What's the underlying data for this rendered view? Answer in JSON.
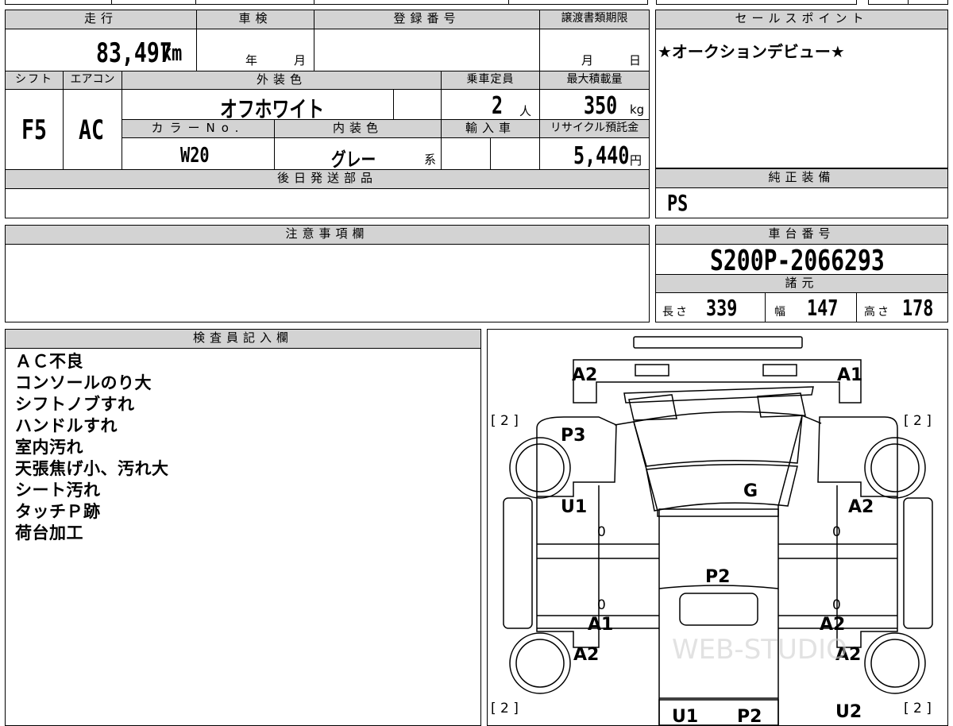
{
  "top_strip": {
    "partial_text": ""
  },
  "main": {
    "mileage_header": "走行",
    "mileage_value": "83,497",
    "mileage_unit": "km",
    "inspection_header": "車検",
    "inspection_year": "年",
    "inspection_month": "月",
    "reg_no_header": "登録番号",
    "reg_no_value": "",
    "transfer_header": "譲渡書類期限",
    "transfer_month": "月",
    "transfer_day": "日",
    "shift_header": "シフト",
    "shift_value": "F5",
    "ac_header": "エアコン",
    "ac_value": "AC",
    "exterior_header": "外装色",
    "exterior_value": "オフホワイト",
    "color_no_header": "カラーNo.",
    "color_no_value": "W20",
    "interior_header": "内装色",
    "interior_value": "グレー",
    "interior_suffix": "系",
    "capacity_header": "乗車定員",
    "capacity_value": "2",
    "capacity_unit": "人",
    "max_load_header": "最大積載量",
    "max_load_value": "350",
    "max_load_unit": "kg",
    "import_header": "輸入車",
    "recycle_header": "リサイクル預託金",
    "recycle_value": "5,440",
    "recycle_unit": "円",
    "later_parts_header": "後日発送部品",
    "later_parts_value": ""
  },
  "sales_point": {
    "header": "セールスポイント",
    "text": "★オークションデビュー★"
  },
  "equipment": {
    "header": "純正装備",
    "value": "PS"
  },
  "caution": {
    "header": "注意事項欄",
    "text": ""
  },
  "chassis": {
    "header": "車台番号",
    "number": "S200P-2066293",
    "spec_header": "諸元",
    "length_label": "長さ",
    "length_value": "339",
    "width_label": "幅",
    "width_value": "147",
    "height_label": "高さ",
    "height_value": "178"
  },
  "inspector": {
    "header": "検査員記入欄",
    "notes": [
      "ＡＣ不良",
      "コンソールのり大",
      "シフトノブすれ",
      "ハンドルすれ",
      "室内汚れ",
      "天張焦げ小、汚れ大",
      "シート汚れ",
      "タッチＰ跡",
      "荷台加工"
    ]
  },
  "diagram": {
    "labels": {
      "front_left": "A2",
      "front_right": "A1",
      "front_left_fender": "P3",
      "hood": "G",
      "left_front_door": "U1",
      "right_front_door": "A2",
      "roof": "P2",
      "left_sill": "A1",
      "right_sill": "A2",
      "left_rear": "A2",
      "right_rear": "A2",
      "bottom_left": "U1",
      "bottom_center": "P2",
      "bottom_right": "U2"
    },
    "tire_marks": [
      "[ 2 ]",
      "[ 2 ]",
      "[ 2 ]",
      "[ 2 ]"
    ],
    "zeros": [
      "0",
      "0",
      "0",
      "0"
    ],
    "watermark": "WEB-STUDIO"
  }
}
